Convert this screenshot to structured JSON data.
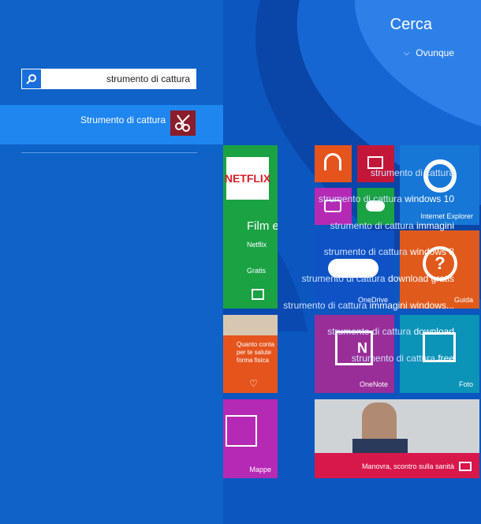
{
  "colors": {
    "panel": "#0e62c8",
    "selected": "#1f86f0",
    "ie_tile": "#1677d6",
    "netflix_tile": "#1aa243",
    "help_tile": "#e05a1c",
    "onedrive_tile": "#0f52c6",
    "onenote_tile": "#9a2e98",
    "foto_tile": "#0b93b8",
    "health_tile": "#e5541d",
    "maps_tile": "#b52ab4",
    "news_tile": "#d8174a"
  },
  "search": {
    "title": "Cerca",
    "scope": "Ovunque",
    "query": "strumento di cattura",
    "icon": "search-icon"
  },
  "top_result": {
    "label": "Strumento di cattura",
    "icon": "snipping-tool-icon"
  },
  "suggestions": [
    {
      "prefix": "strumento di cattura",
      "suffix": ""
    },
    {
      "prefix": "strumento di cattura",
      "suffix": " windows 10"
    },
    {
      "prefix": "strumento di cattura",
      "suffix": " immagini"
    },
    {
      "prefix": "strumento di cattura",
      "suffix": " windows 8"
    },
    {
      "prefix": "strumento di cattura",
      "suffix": " download gratis"
    },
    {
      "prefix": "strumento di cattura",
      "suffix": " immagini windows..."
    },
    {
      "prefix": "strumento di cattura",
      "suffix": " download"
    },
    {
      "prefix": "strumento di cattura",
      "suffix": " free"
    }
  ],
  "tiles": {
    "netflix_logo": "NETFLIX",
    "netflix_text": "Film e s",
    "netflix_name": "Netflix",
    "netflix_price": "Gratis",
    "ie": "Internet Explorer",
    "help": "Guida",
    "onedrive": "OneDrive",
    "onenote": "OneNote",
    "foto": "Foto",
    "health_text": "Quanto conta per te salute forma fisica",
    "maps": "Mappe",
    "news": "Manovra, scontro sulla sanità"
  }
}
